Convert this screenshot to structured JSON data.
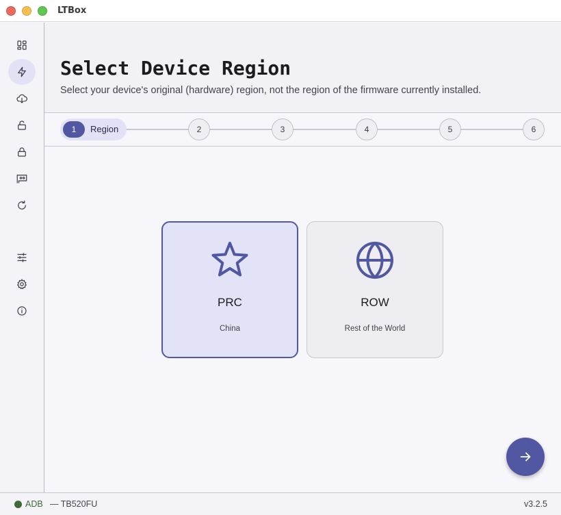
{
  "window": {
    "title": "LTBox"
  },
  "sidebar": {
    "items": [
      {
        "id": "dashboard",
        "icon": "dashboard-icon",
        "active": false
      },
      {
        "id": "flash",
        "icon": "lightning-icon",
        "active": true
      },
      {
        "id": "download",
        "icon": "cloud-download-icon",
        "active": false
      },
      {
        "id": "unlock",
        "icon": "unlock-icon",
        "active": false
      },
      {
        "id": "lock",
        "icon": "lock-icon",
        "active": false
      },
      {
        "id": "device",
        "icon": "device-card-icon",
        "active": false
      },
      {
        "id": "refresh",
        "icon": "refresh-icon",
        "active": false
      },
      {
        "id": "tune",
        "icon": "sliders-icon",
        "active": false
      },
      {
        "id": "settings",
        "icon": "gear-icon",
        "active": false
      },
      {
        "id": "info",
        "icon": "info-icon",
        "active": false
      }
    ]
  },
  "header": {
    "title": "Select Device Region",
    "subtitle": "Select your device's original (hardware) region, not the region of the firmware currently installed."
  },
  "stepper": {
    "current": 1,
    "steps": [
      {
        "number": "1",
        "label": "Region"
      },
      {
        "number": "2"
      },
      {
        "number": "3"
      },
      {
        "number": "4"
      },
      {
        "number": "5"
      },
      {
        "number": "6"
      }
    ]
  },
  "regions": [
    {
      "code": "PRC",
      "description": "China",
      "icon": "star-icon",
      "selected": true
    },
    {
      "code": "ROW",
      "description": "Rest of the World",
      "icon": "globe-icon",
      "selected": false
    }
  ],
  "fab": {
    "icon": "arrow-right-icon"
  },
  "status": {
    "connection": "ADB",
    "device": "— TB520FU",
    "version": "v3.2.5"
  },
  "colors": {
    "accent": "#5157a0",
    "selected_card": "#e2e3f7",
    "status_ok": "#3d6b33"
  }
}
